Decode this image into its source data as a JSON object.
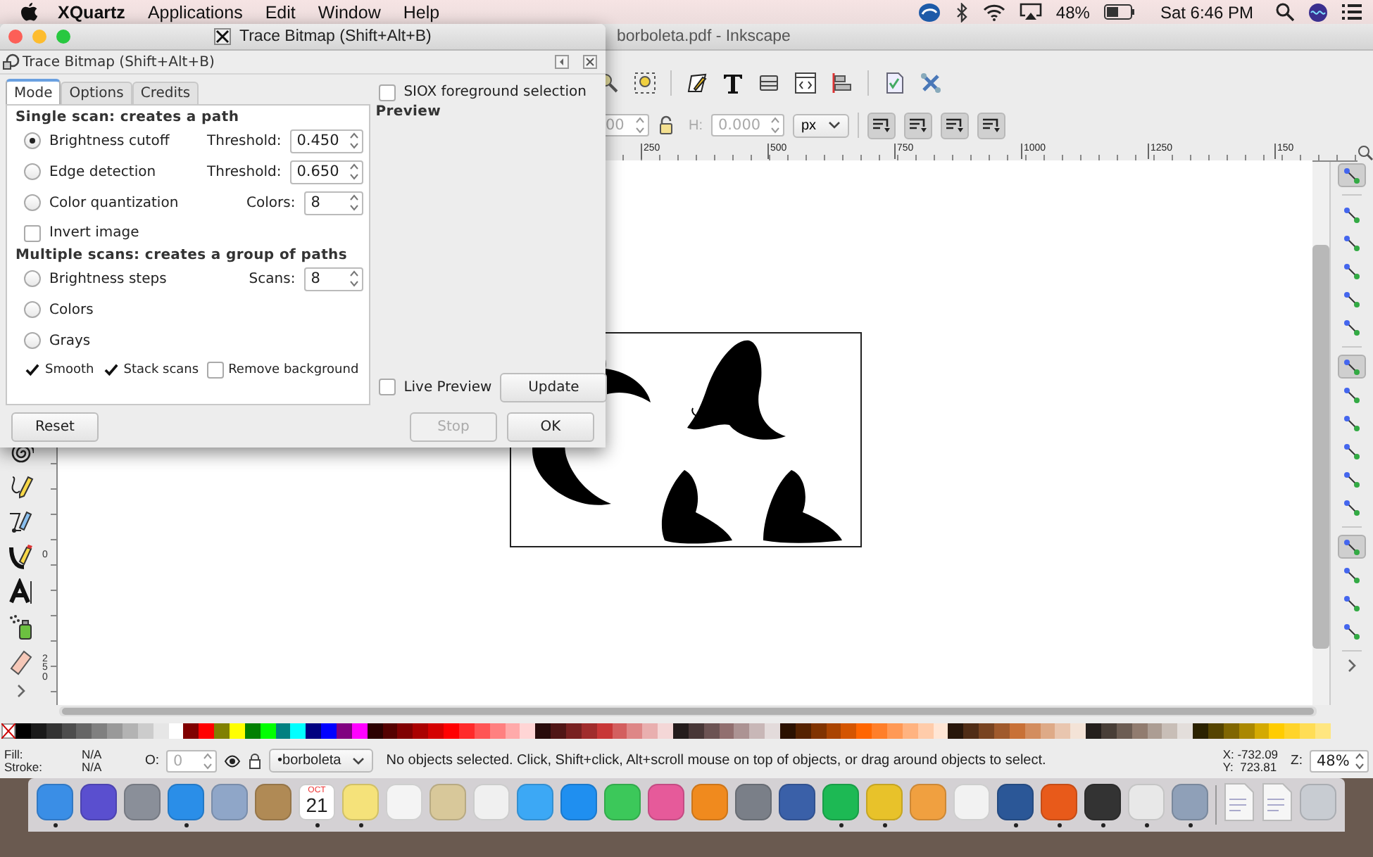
{
  "menubar": {
    "app": "XQuartz",
    "menus": [
      "Applications",
      "Edit",
      "Window",
      "Help"
    ],
    "battery": "48%",
    "clock": "Sat 6:46 PM"
  },
  "window": {
    "title": "borboleta.pdf - Inkscape"
  },
  "tool_controls": {
    "w_value": "00",
    "h_label": "H:",
    "h_value": "0.000",
    "unit": "px"
  },
  "ruler": {
    "h_labels": [
      "250",
      "500",
      "750",
      "1000",
      "1250",
      "150"
    ],
    "v_labels": [
      "0",
      "250"
    ]
  },
  "snap_groups": [
    {
      "items": [
        {
          "on": true
        }
      ]
    },
    {
      "items": [
        {
          "on": false
        },
        {
          "on": false
        },
        {
          "on": false
        },
        {
          "on": false
        },
        {
          "on": false
        }
      ]
    },
    {
      "items": [
        {
          "on": true
        },
        {
          "on": false
        },
        {
          "on": false
        },
        {
          "on": false
        },
        {
          "on": false
        },
        {
          "on": false
        }
      ]
    },
    {
      "items": [
        {
          "on": true
        },
        {
          "on": false
        },
        {
          "on": false
        },
        {
          "on": false
        }
      ]
    }
  ],
  "palette": [
    {
      "color": "#000000"
    },
    {
      "color": "#1a1a1a"
    },
    {
      "color": "#333333"
    },
    {
      "color": "#4d4d4d"
    },
    {
      "color": "#666666"
    },
    {
      "color": "#808080"
    },
    {
      "color": "#999999"
    },
    {
      "color": "#b3b3b3"
    },
    {
      "color": "#cccccc"
    },
    {
      "color": "#e6e6e6"
    },
    {
      "color": "#ffffff"
    },
    {
      "color": "#800000"
    },
    {
      "color": "#ff0000"
    },
    {
      "color": "#808000"
    },
    {
      "color": "#ffff00"
    },
    {
      "color": "#008000"
    },
    {
      "color": "#00ff00"
    },
    {
      "color": "#008080"
    },
    {
      "color": "#00ffff"
    },
    {
      "color": "#000080"
    },
    {
      "color": "#0000ff"
    },
    {
      "color": "#800080"
    },
    {
      "color": "#ff00ff"
    },
    {
      "color": "#2b0000"
    },
    {
      "color": "#550000"
    },
    {
      "color": "#800001"
    },
    {
      "color": "#aa0000"
    },
    {
      "color": "#d40000"
    },
    {
      "color": "#ff0001"
    },
    {
      "color": "#ff2a2a"
    },
    {
      "color": "#ff5555"
    },
    {
      "color": "#ff8080"
    },
    {
      "color": "#ffaaaa"
    },
    {
      "color": "#ffd5d5"
    },
    {
      "color": "#280b0b"
    },
    {
      "color": "#501616"
    },
    {
      "color": "#782121"
    },
    {
      "color": "#a02c2c"
    },
    {
      "color": "#c83737"
    },
    {
      "color": "#d35f5f"
    },
    {
      "color": "#de8787"
    },
    {
      "color": "#e9afaf"
    },
    {
      "color": "#f4d7d7"
    },
    {
      "color": "#241c1c"
    },
    {
      "color": "#483737"
    },
    {
      "color": "#6c5353"
    },
    {
      "color": "#916f6f"
    },
    {
      "color": "#ac9393"
    },
    {
      "color": "#c8b7b7"
    },
    {
      "color": "#e3dbdb"
    },
    {
      "color": "#2b1100"
    },
    {
      "color": "#552200"
    },
    {
      "color": "#803300"
    },
    {
      "color": "#aa4400"
    },
    {
      "color": "#d45500"
    },
    {
      "color": "#ff6600"
    },
    {
      "color": "#ff7f2a"
    },
    {
      "color": "#ff9955"
    },
    {
      "color": "#ffb380"
    },
    {
      "color": "#ffccaa"
    },
    {
      "color": "#ffe6d5"
    },
    {
      "color": "#28170b"
    },
    {
      "color": "#502d16"
    },
    {
      "color": "#784421"
    },
    {
      "color": "#a05a2c"
    },
    {
      "color": "#c87137"
    },
    {
      "color": "#d38d5f"
    },
    {
      "color": "#deaa87"
    },
    {
      "color": "#e9c6af"
    },
    {
      "color": "#f4e3d7"
    },
    {
      "color": "#241f1c"
    },
    {
      "color": "#483e37"
    },
    {
      "color": "#6c5d53"
    },
    {
      "color": "#917c6f"
    },
    {
      "color": "#ac9d93"
    },
    {
      "color": "#c8beb7"
    },
    {
      "color": "#e3dedb"
    },
    {
      "color": "#2b2200"
    },
    {
      "color": "#554400"
    },
    {
      "color": "#806600"
    },
    {
      "color": "#aa8800"
    },
    {
      "color": "#d4aa00"
    },
    {
      "color": "#ffcc00"
    },
    {
      "color": "#ffd42a"
    },
    {
      "color": "#ffdd55"
    },
    {
      "color": "#ffe680"
    }
  ],
  "status_bar": {
    "fill_label": "Fill:",
    "fill_value": "N/A",
    "stroke_label": "Stroke:",
    "stroke_value": "N/A",
    "opacity_label": "O:",
    "opacity_value": "0",
    "layer": "•borboleta",
    "message": "No objects selected. Click, Shift+click, Alt+scroll mouse on top of objects, or drag around objects to select.",
    "x": "X: -732.09",
    "y": "Y:  723.81",
    "zoom_label": "Z:",
    "zoom_value": "48%"
  },
  "dock": [
    {
      "kind": "app",
      "color": "#3a8ee6",
      "running": true
    },
    {
      "kind": "app",
      "color": "#5a4fcf",
      "running": false
    },
    {
      "kind": "app",
      "color": "#8a8f99",
      "running": false
    },
    {
      "kind": "app",
      "color": "#2a8ee8",
      "running": true
    },
    {
      "kind": "app",
      "color": "#8fa6c8",
      "running": false
    },
    {
      "kind": "app",
      "color": "#b08a55",
      "running": false
    },
    {
      "kind": "calendar",
      "month": "OCT",
      "day": "21",
      "running": true
    },
    {
      "kind": "app",
      "color": "#f5e27a",
      "running": true
    },
    {
      "kind": "app",
      "color": "#f4f4f4",
      "running": false
    },
    {
      "kind": "app",
      "color": "#d8c89a",
      "running": false
    },
    {
      "kind": "app",
      "color": "#f0f0f0",
      "running": false
    },
    {
      "kind": "app",
      "color": "#3ca8f5",
      "running": false
    },
    {
      "kind": "app",
      "color": "#1f8ff0",
      "running": false
    },
    {
      "kind": "app",
      "color": "#3cc85a",
      "running": false
    },
    {
      "kind": "app",
      "color": "#e65a9a",
      "running": false
    },
    {
      "kind": "app",
      "color": "#f08a1e",
      "running": false
    },
    {
      "kind": "app",
      "color": "#7a7f88",
      "running": false
    },
    {
      "kind": "app",
      "color": "#3a60a8",
      "running": false
    },
    {
      "kind": "app",
      "color": "#1db954",
      "running": true
    },
    {
      "kind": "app",
      "color": "#e8c22a",
      "running": true
    },
    {
      "kind": "app",
      "color": "#f0a040",
      "running": false
    },
    {
      "kind": "app",
      "color": "#f2f2f2",
      "running": false
    },
    {
      "kind": "app",
      "color": "#2b5797",
      "running": true
    },
    {
      "kind": "app",
      "color": "#e85a1a",
      "running": true
    },
    {
      "kind": "app",
      "color": "#333333",
      "running": true
    },
    {
      "kind": "app",
      "color": "#e8e8e8",
      "running": true
    },
    {
      "kind": "app",
      "color": "#8fa0b8",
      "running": true
    },
    {
      "kind": "separator"
    },
    {
      "kind": "doc"
    },
    {
      "kind": "doc"
    },
    {
      "kind": "app",
      "color": "#c8ccd2",
      "running": false
    }
  ],
  "dialog": {
    "window_title": "Trace Bitmap (Shift+Alt+B)",
    "panel_title": "Trace Bitmap (Shift+Alt+B)",
    "tabs": [
      {
        "label": "Mode",
        "selected": true
      },
      {
        "label": "Options",
        "selected": false
      },
      {
        "label": "Credits",
        "selected": false
      }
    ],
    "single": {
      "heading": "Single scan: creates a path",
      "items": [
        {
          "label": "Brightness cutoff",
          "selected": true,
          "param_label": "Threshold:",
          "param_value": "0.450"
        },
        {
          "label": "Edge detection",
          "selected": false,
          "param_label": "Threshold:",
          "param_value": "0.650"
        },
        {
          "label": "Color quantization",
          "selected": false,
          "param_label": "Colors:",
          "param_value": "8"
        }
      ]
    },
    "invert": {
      "label": "Invert image",
      "checked": false
    },
    "multiple": {
      "heading": "Multiple scans: creates a group of paths",
      "items": [
        {
          "label": "Brightness steps",
          "selected": false,
          "param_label": "Scans:",
          "param_value": "8"
        },
        {
          "label": "Colors",
          "selected": false
        },
        {
          "label": "Grays",
          "selected": false
        }
      ]
    },
    "options": [
      {
        "label": "Smooth",
        "checked": true
      },
      {
        "label": "Stack scans",
        "checked": true
      },
      {
        "label": "Remove background",
        "checked": false
      }
    ],
    "siox": {
      "label": "SIOX foreground selection",
      "checked": false
    },
    "preview_label": "Preview",
    "live_preview": {
      "label": "Live Preview",
      "checked": false
    },
    "update_button": "Update",
    "reset_button": "Reset",
    "stop_button": {
      "label": "Stop",
      "disabled": true
    },
    "ok_button": "OK"
  }
}
